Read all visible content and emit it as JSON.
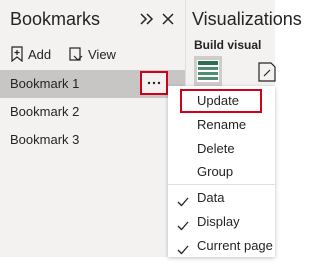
{
  "bookmarks": {
    "title": "Bookmarks",
    "add_label": "Add",
    "view_label": "View",
    "items": [
      {
        "label": "Bookmark 1"
      },
      {
        "label": "Bookmark 2"
      },
      {
        "label": "Bookmark 3"
      }
    ]
  },
  "visualizations": {
    "title": "Visualizations",
    "build_visual": "Build visual"
  },
  "menu": {
    "items": [
      {
        "label": "Update"
      },
      {
        "label": "Rename"
      },
      {
        "label": "Delete"
      },
      {
        "label": "Group"
      }
    ],
    "checks": [
      {
        "label": "Data"
      },
      {
        "label": "Display"
      },
      {
        "label": "Current page"
      }
    ]
  },
  "colors": {
    "highlight_border": "#d0021b",
    "selected_row": "#c8c6c4",
    "pane_background": "#f3f2f1",
    "visual_tile": "#2f6f4f"
  }
}
